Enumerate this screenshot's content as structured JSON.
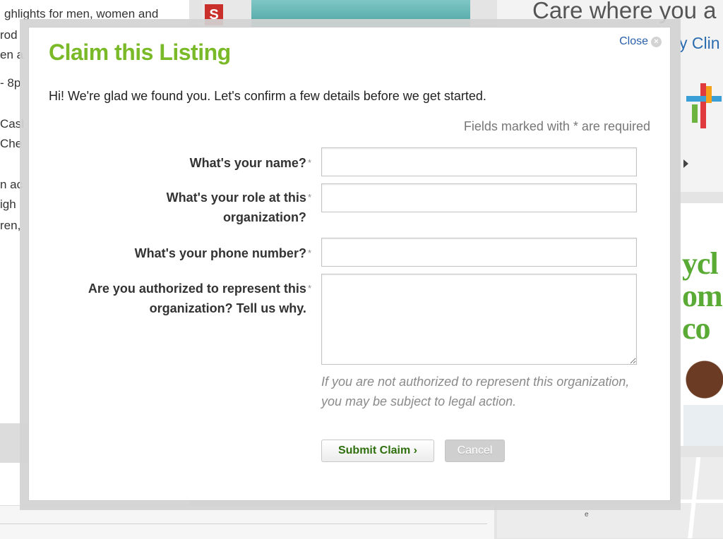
{
  "background": {
    "left_text_fragments": [
      "ghlights for men, women and",
      "rod",
      "en a",
      "- 8p",
      "Casl",
      "Che",
      "n ac",
      "igh",
      "ren,"
    ],
    "ad_headline": "Care where you a",
    "ad_subline": "y Clin",
    "ad2_lines": [
      "ycl",
      "om",
      "co"
    ],
    "map_label": "e"
  },
  "modal": {
    "title": "Claim this Listing",
    "close_label": "Close",
    "close_icon": "×",
    "intro": "Hi! We're glad we found you. Let's confirm a few details before we get started.",
    "required_note": "Fields marked with * are required",
    "required_marker": "*",
    "fields": [
      {
        "label": "What's your name?",
        "value": ""
      },
      {
        "label": "What's your role at this organization?",
        "value": ""
      },
      {
        "label": "What's your phone number?",
        "value": ""
      },
      {
        "label": "Are you authorized to represent this organization? Tell us why.",
        "value": ""
      }
    ],
    "legal_note": "If you are not authorized to represent this organization, you may be subject to legal action.",
    "submit_label": "Submit Claim ›",
    "cancel_label": "Cancel"
  }
}
